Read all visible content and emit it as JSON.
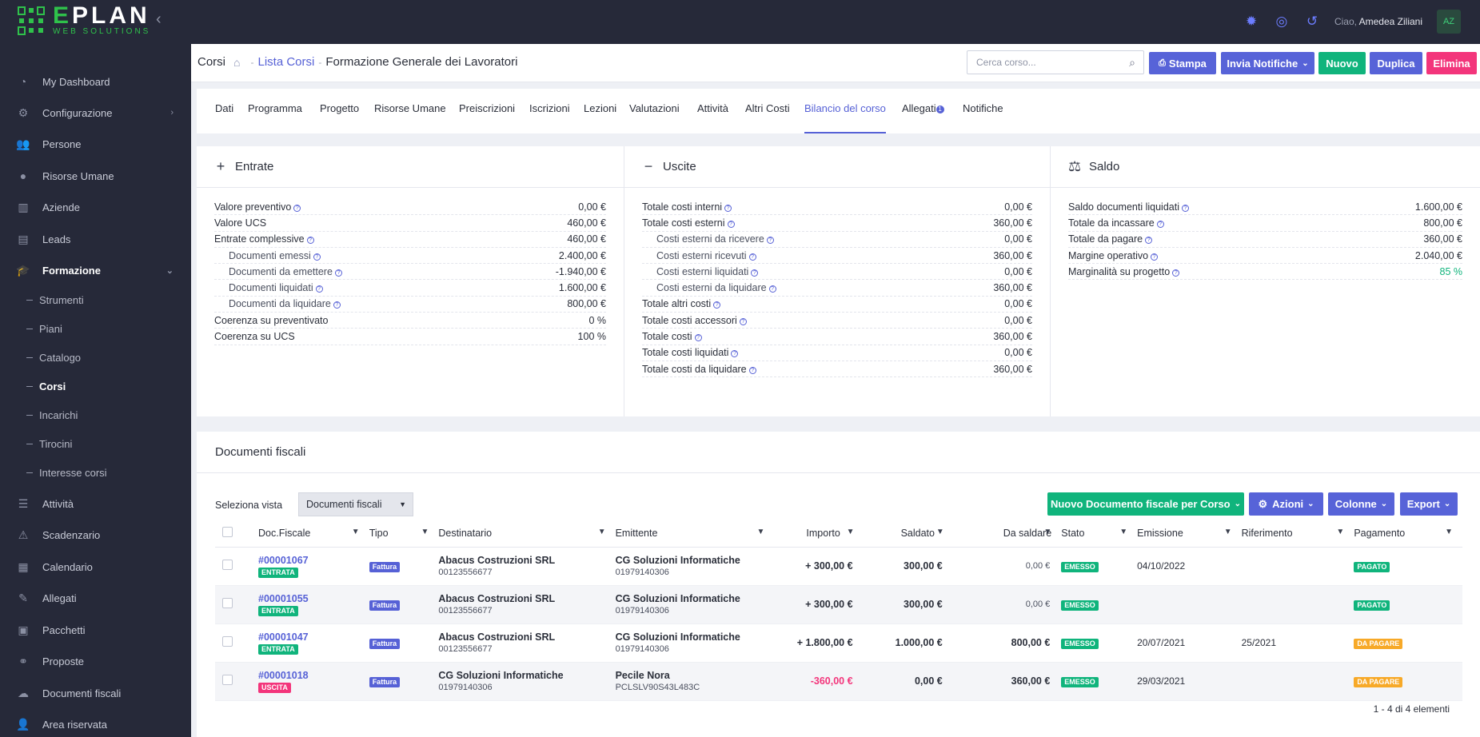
{
  "brand": {
    "logo_main": "PLAN",
    "logo_letter": "E",
    "logo_sub": "WEB SOLUTIONS"
  },
  "topbar": {
    "greeting": "Ciao,",
    "user_name": "Amedea Ziliani",
    "avatar_initials": "AZ"
  },
  "sidebar": {
    "items": [
      {
        "label": "My Dashboard",
        "icon": "dashboard-icon"
      },
      {
        "label": "Configurazione",
        "icon": "gear-icon"
      },
      {
        "label": "Persone",
        "icon": "people-icon"
      },
      {
        "label": "Risorse Umane",
        "icon": "person-icon"
      },
      {
        "label": "Aziende",
        "icon": "chart-icon"
      },
      {
        "label": "Leads",
        "icon": "contact-icon"
      },
      {
        "label": "Formazione",
        "icon": "graduation-icon"
      },
      {
        "label": "Attività",
        "icon": "list-icon"
      },
      {
        "label": "Scadenzario",
        "icon": "warning-icon"
      },
      {
        "label": "Calendario",
        "icon": "calendar-icon"
      },
      {
        "label": "Allegati",
        "icon": "paperclip-icon"
      },
      {
        "label": "Pacchetti",
        "icon": "package-icon"
      },
      {
        "label": "Proposte",
        "icon": "handshake-icon"
      },
      {
        "label": "Documenti fiscali",
        "icon": "cloud-icon"
      },
      {
        "label": "Area riservata",
        "icon": "users-icon"
      }
    ],
    "sub_items": [
      "Strumenti",
      "Piani",
      "Catalogo",
      "Corsi",
      "Incarichi",
      "Tirocini",
      "Interesse corsi"
    ]
  },
  "header": {
    "crumb_root": "Corsi",
    "crumb_link": "Lista Corsi",
    "crumb_current": "Formazione Generale dei Lavoratori",
    "search_placeholder": "Cerca corso...",
    "btn_stampa": "Stampa",
    "btn_invia": "Invia Notifiche",
    "btn_nuovo": "Nuovo",
    "btn_duplica": "Duplica",
    "btn_elimina": "Elimina"
  },
  "tabs": [
    "Dati",
    "Programma",
    "Progetto",
    "Risorse Umane",
    "Preiscrizioni",
    "Iscrizioni",
    "Lezioni",
    "Valutazioni",
    "Attività",
    "Altri Costi",
    "Bilancio del corso",
    "Allegati",
    "Notifiche"
  ],
  "tab_badge": "1",
  "entrate": {
    "title": "Entrate",
    "rows": [
      {
        "label": "Valore preventivo",
        "value": "0,00 €"
      },
      {
        "label": "Valore UCS",
        "value": "460,00 €"
      },
      {
        "label": "Entrate complessive",
        "value": "460,00 €"
      },
      {
        "label": "Documenti emessi",
        "value": "2.400,00 €"
      },
      {
        "label": "Documenti da emettere",
        "value": "-1.940,00 €"
      },
      {
        "label": "Documenti liquidati",
        "value": "1.600,00 €"
      },
      {
        "label": "Documenti da liquidare",
        "value": "800,00 €"
      },
      {
        "label": "Coerenza su preventivato",
        "value": "0 %"
      },
      {
        "label": "Coerenza su UCS",
        "value": "100 %"
      }
    ]
  },
  "uscite": {
    "title": "Uscite",
    "rows": [
      {
        "label": "Totale costi interni",
        "value": "0,00 €"
      },
      {
        "label": "Totale costi esterni",
        "value": "360,00 €"
      },
      {
        "label": "Costi esterni da ricevere",
        "value": "0,00 €"
      },
      {
        "label": "Costi esterni ricevuti",
        "value": "360,00 €"
      },
      {
        "label": "Costi esterni liquidati",
        "value": "0,00 €"
      },
      {
        "label": "Costi esterni da liquidare",
        "value": "360,00 €"
      },
      {
        "label": "Totale altri costi",
        "value": "0,00 €"
      },
      {
        "label": "Totale costi accessori",
        "value": "0,00 €"
      },
      {
        "label": "Totale costi",
        "value": "360,00 €"
      },
      {
        "label": "Totale costi liquidati",
        "value": "0,00 €"
      },
      {
        "label": "Totale costi da liquidare",
        "value": "360,00 €"
      }
    ]
  },
  "saldo": {
    "title": "Saldo",
    "rows": [
      {
        "label": "Saldo documenti liquidati",
        "value": "1.600,00 €"
      },
      {
        "label": "Totale da incassare",
        "value": "800,00 €"
      },
      {
        "label": "Totale da pagare",
        "value": "360,00 €"
      },
      {
        "label": "Margine operativo",
        "value": "2.040,00 €"
      },
      {
        "label": "Marginalità su progetto",
        "value": "85 %"
      }
    ]
  },
  "docs": {
    "title": "Documenti fiscali",
    "vista_label": "Seleziona vista",
    "vista_value": "Documenti fiscali",
    "btn_nuovo_doc": "Nuovo Documento fiscale per Corso",
    "btn_azioni": "Azioni",
    "btn_colonne": "Colonne",
    "btn_export": "Export",
    "columns": [
      "Doc.Fiscale",
      "Tipo",
      "Destinatario",
      "Emittente",
      "Importo",
      "Saldato",
      "Da saldare",
      "Stato",
      "Emissione",
      "Riferimento",
      "Pagamento"
    ],
    "rows": [
      {
        "num": "#00001067",
        "dir": "ENTRATA",
        "tipo": "Fattura",
        "dest_name": "Abacus Costruzioni SRL",
        "dest_code": "00123556677",
        "emit_name": "CG Soluzioni Informatiche",
        "emit_code": "01979140306",
        "importo": "+ 300,00 €",
        "saldato": "300,00 €",
        "da_saldare": "0,00 €",
        "stato": "EMESSO",
        "emissione": "04/10/2022",
        "riferimento": "",
        "pagamento": "PAGATO"
      },
      {
        "num": "#00001055",
        "dir": "ENTRATA",
        "tipo": "Fattura",
        "dest_name": "Abacus Costruzioni SRL",
        "dest_code": "00123556677",
        "emit_name": "CG Soluzioni Informatiche",
        "emit_code": "01979140306",
        "importo": "+ 300,00 €",
        "saldato": "300,00 €",
        "da_saldare": "0,00 €",
        "stato": "EMESSO",
        "emissione": "",
        "riferimento": "",
        "pagamento": "PAGATO"
      },
      {
        "num": "#00001047",
        "dir": "ENTRATA",
        "tipo": "Fattura",
        "dest_name": "Abacus Costruzioni SRL",
        "dest_code": "00123556677",
        "emit_name": "CG Soluzioni Informatiche",
        "emit_code": "01979140306",
        "importo": "+ 1.800,00 €",
        "saldato": "1.000,00 €",
        "da_saldare": "800,00 €",
        "stato": "EMESSO",
        "emissione": "20/07/2021",
        "riferimento": "25/2021",
        "pagamento": "DA PAGARE"
      },
      {
        "num": "#00001018",
        "dir": "USCITA",
        "tipo": "Fattura",
        "dest_name": "CG Soluzioni Informatiche",
        "dest_code": "01979140306",
        "emit_name": "Pecile Nora",
        "emit_code": "PCLSLV90S43L483C",
        "importo": "-360,00 €",
        "saldato": "0,00 €",
        "da_saldare": "360,00 €",
        "stato": "EMESSO",
        "emissione": "29/03/2021",
        "riferimento": "",
        "pagamento": "DA PAGARE"
      }
    ],
    "pager": "1 - 4 di 4 elementi"
  },
  "colors": {
    "accent": "#5661d6",
    "green": "#10b47c",
    "pink": "#f3357b",
    "orange": "#f7a928",
    "sidebar": "#262939"
  }
}
